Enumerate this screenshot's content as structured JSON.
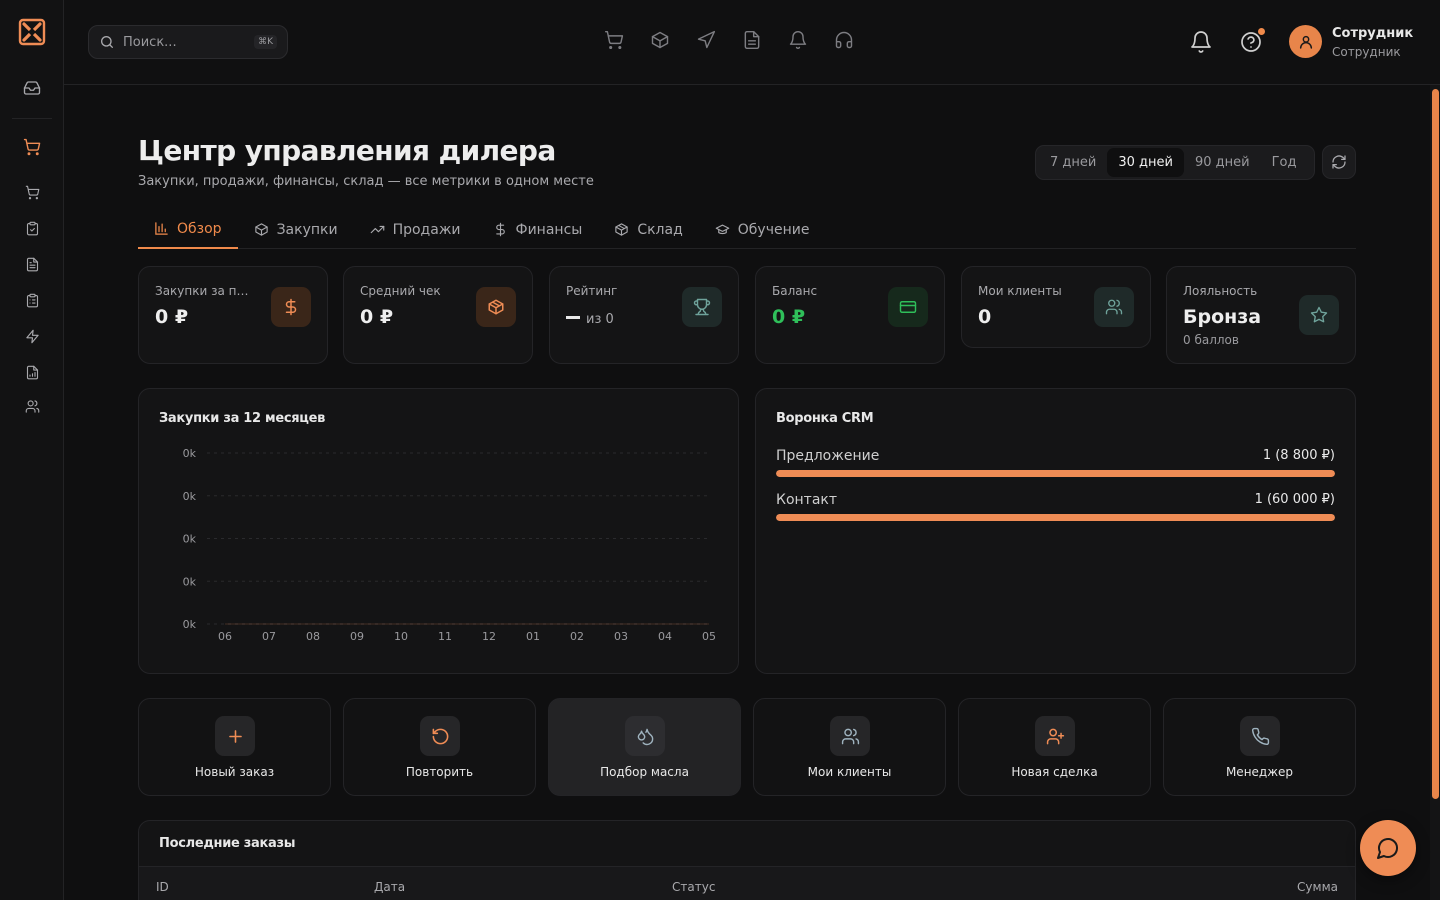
{
  "colors": {
    "accent": "#ef8c55",
    "green": "#2fbf5a",
    "background": "#0f0f10",
    "card": "#141415"
  },
  "sidebar": {
    "logo": "x-logo-icon",
    "items": [
      "inbox-icon",
      "cart-icon",
      "cart-small-icon",
      "clipboard-icon",
      "file-icon",
      "clipboard-list-icon",
      "zap-icon",
      "file-chart-icon",
      "users-icon"
    ]
  },
  "header": {
    "search": {
      "placeholder": "Поиск...",
      "shortcut": "⌘K"
    },
    "nav_icons": [
      "cart-icon",
      "box-icon",
      "send-icon",
      "file-text-icon",
      "bell-icon",
      "headphones-icon"
    ],
    "user": {
      "name": "Сотрудник",
      "role": "Сотрудник"
    }
  },
  "page": {
    "title": "Центр управления дилера",
    "subtitle": "Закупки, продажи, финансы, склад — все метрики в одном месте"
  },
  "period": {
    "options": [
      "7 дней",
      "30 дней",
      "90 дней",
      "Год"
    ],
    "selected": "30 дней"
  },
  "tabs": [
    {
      "label": "Обзор",
      "icon": "bar-chart-icon",
      "active": true
    },
    {
      "label": "Закупки",
      "icon": "box-icon"
    },
    {
      "label": "Продажи",
      "icon": "trending-up-icon"
    },
    {
      "label": "Финансы",
      "icon": "dollar-icon"
    },
    {
      "label": "Склад",
      "icon": "package-icon"
    },
    {
      "label": "Обучение",
      "icon": "graduation-cap-icon"
    }
  ],
  "kpis": [
    {
      "label": "Закупки за пер...",
      "value": "0 ₽",
      "icon": "dollar-icon"
    },
    {
      "label": "Средний чек",
      "value": "0 ₽",
      "icon": "box-icon"
    },
    {
      "label": "Рейтинг",
      "value": "из 0",
      "icon": "trophy-icon"
    },
    {
      "label": "Баланс",
      "value": "0 ₽",
      "icon": "credit-card-icon"
    },
    {
      "label": "Мои клиенты",
      "value": "0",
      "icon": "users-icon"
    },
    {
      "label": "Лояльность",
      "value": "Бронза",
      "extra": "0 баллов",
      "icon": "star-icon"
    }
  ],
  "purchases_chart": {
    "title": "Закупки за 12 месяцев"
  },
  "chart_data": {
    "type": "area",
    "title": "Закупки за 12 месяцев",
    "categories": [
      "06",
      "07",
      "08",
      "09",
      "10",
      "11",
      "12",
      "01",
      "02",
      "03",
      "04",
      "05"
    ],
    "values": [
      0,
      0,
      0,
      0,
      0,
      0,
      0,
      0,
      0,
      0,
      0,
      0
    ],
    "y_tick_labels": [
      "0k",
      "0k",
      "0k",
      "0k",
      "0k"
    ],
    "grid": true
  },
  "funnel": {
    "title": "Воронка CRM",
    "stages": [
      {
        "label": "Предложение",
        "value": "1 (8 800 ₽)",
        "fill": 1.0
      },
      {
        "label": "Контакт",
        "value": "1 (60 000 ₽)",
        "fill": 1.0
      }
    ]
  },
  "actions": [
    {
      "label": "Новый заказ",
      "icon": "plus-icon"
    },
    {
      "label": "Повторить",
      "icon": "rotate-icon"
    },
    {
      "label": "Подбор масла",
      "icon": "droplets-icon",
      "active": true
    },
    {
      "label": "Мои клиенты",
      "icon": "users-icon"
    },
    {
      "label": "Новая сделка",
      "icon": "user-plus-icon"
    },
    {
      "label": "Менеджер",
      "icon": "phone-icon"
    }
  ],
  "orders": {
    "title": "Последние заказы",
    "columns": [
      "ID",
      "Дата",
      "Статус",
      "Сумма"
    ]
  }
}
